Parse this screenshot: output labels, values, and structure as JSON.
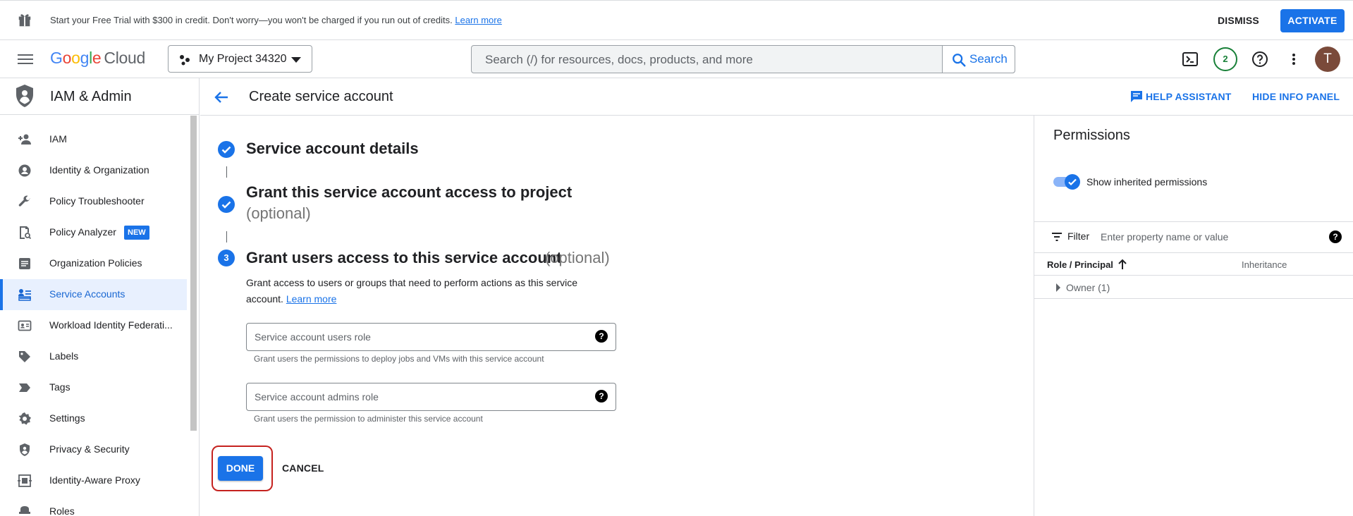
{
  "banner": {
    "message": "Start your Free Trial with $300 in credit. Don't worry—you won't be charged if you run out of credits.",
    "learn_more": "Learn more",
    "dismiss": "DISMISS",
    "activate": "ACTIVATE"
  },
  "header": {
    "logo_google": [
      "G",
      "o",
      "o",
      "g",
      "l",
      "e"
    ],
    "logo_cloud": "Cloud",
    "project": "My Project 34320",
    "search_placeholder": "Search (/) for resources, docs, products, and more",
    "search_button": "Search",
    "notifications": "2",
    "avatar_initial": "T"
  },
  "sidebar": {
    "title": "IAM & Admin",
    "items": [
      {
        "label": "IAM",
        "icon": "person-add-icon"
      },
      {
        "label": "Identity & Organization",
        "icon": "account-circle-icon"
      },
      {
        "label": "Policy Troubleshooter",
        "icon": "wrench-icon"
      },
      {
        "label": "Policy Analyzer",
        "icon": "policy-icon",
        "badge": "NEW"
      },
      {
        "label": "Organization Policies",
        "icon": "document-icon"
      },
      {
        "label": "Service Accounts",
        "icon": "service-account-icon",
        "active": true
      },
      {
        "label": "Workload Identity Federati...",
        "icon": "id-card-icon"
      },
      {
        "label": "Labels",
        "icon": "tag-icon"
      },
      {
        "label": "Tags",
        "icon": "label-arrow-icon"
      },
      {
        "label": "Settings",
        "icon": "gear-icon"
      },
      {
        "label": "Privacy & Security",
        "icon": "shield-icon"
      },
      {
        "label": "Identity-Aware Proxy",
        "icon": "proxy-icon"
      },
      {
        "label": "Roles",
        "icon": "roles-icon"
      }
    ]
  },
  "page": {
    "title": "Create service account",
    "help_assistant": "HELP ASSISTANT",
    "hide_info_panel": "HIDE INFO PANEL"
  },
  "steps": {
    "step1_title": "Service account details",
    "step2_title": "Grant this service account access to project",
    "step2_optional": "(optional)",
    "step3_number": "3",
    "step3_title": "Grant users access to this service account",
    "step3_optional": "(optional)",
    "step3_desc": "Grant access to users or groups that need to perform actions as this service account.",
    "step3_learn_more": "Learn more",
    "users_role_placeholder": "Service account users role",
    "users_role_hint": "Grant users the permissions to deploy jobs and VMs with this service account",
    "admins_role_placeholder": "Service account admins role",
    "admins_role_hint": "Grant users the permission to administer this service account",
    "done": "DONE",
    "cancel": "CANCEL",
    "field_help": "?"
  },
  "info_panel": {
    "title": "Permissions",
    "toggle_label": "Show inherited permissions",
    "filter_label": "Filter",
    "filter_placeholder": "Enter property name or value",
    "col_role": "Role / Principal",
    "col_inheritance": "Inheritance",
    "row_owner": "Owner (1)"
  },
  "colors": {
    "accent": "#1a73e8",
    "highlight_ring": "#c5221f",
    "notification": "#188038"
  }
}
